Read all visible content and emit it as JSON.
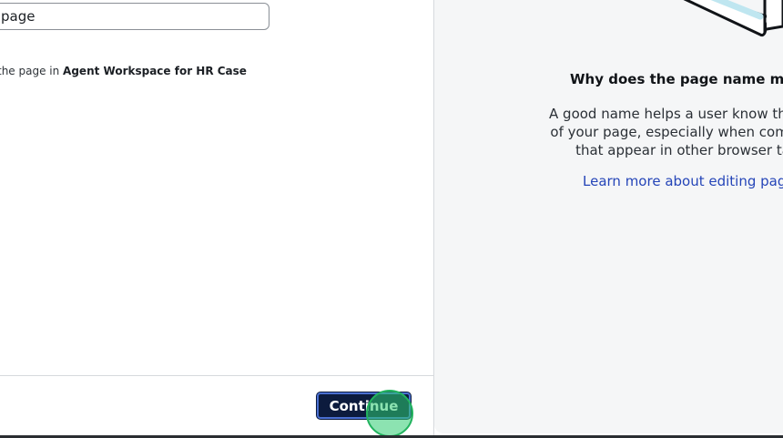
{
  "form": {
    "page_name_value": "page",
    "helper_prefix": "the page in ",
    "helper_bold": "Agent Workspace for HR Case",
    "continue_label": "Continue"
  },
  "info": {
    "heading": "Why does the page name mat",
    "body_lines": [
      "A good name helps a user know the uni",
      "of your page, especially when compare",
      "that appear in other browser ta"
    ],
    "link_text": "Learn more about editing pag"
  },
  "colors": {
    "primary_button": "#0c1b3d",
    "link": "#2545b8",
    "panel_bg": "#f5f6f7",
    "click_marker": "#2ecc71"
  },
  "icons": {
    "illustration": "browser-window-illustration"
  }
}
